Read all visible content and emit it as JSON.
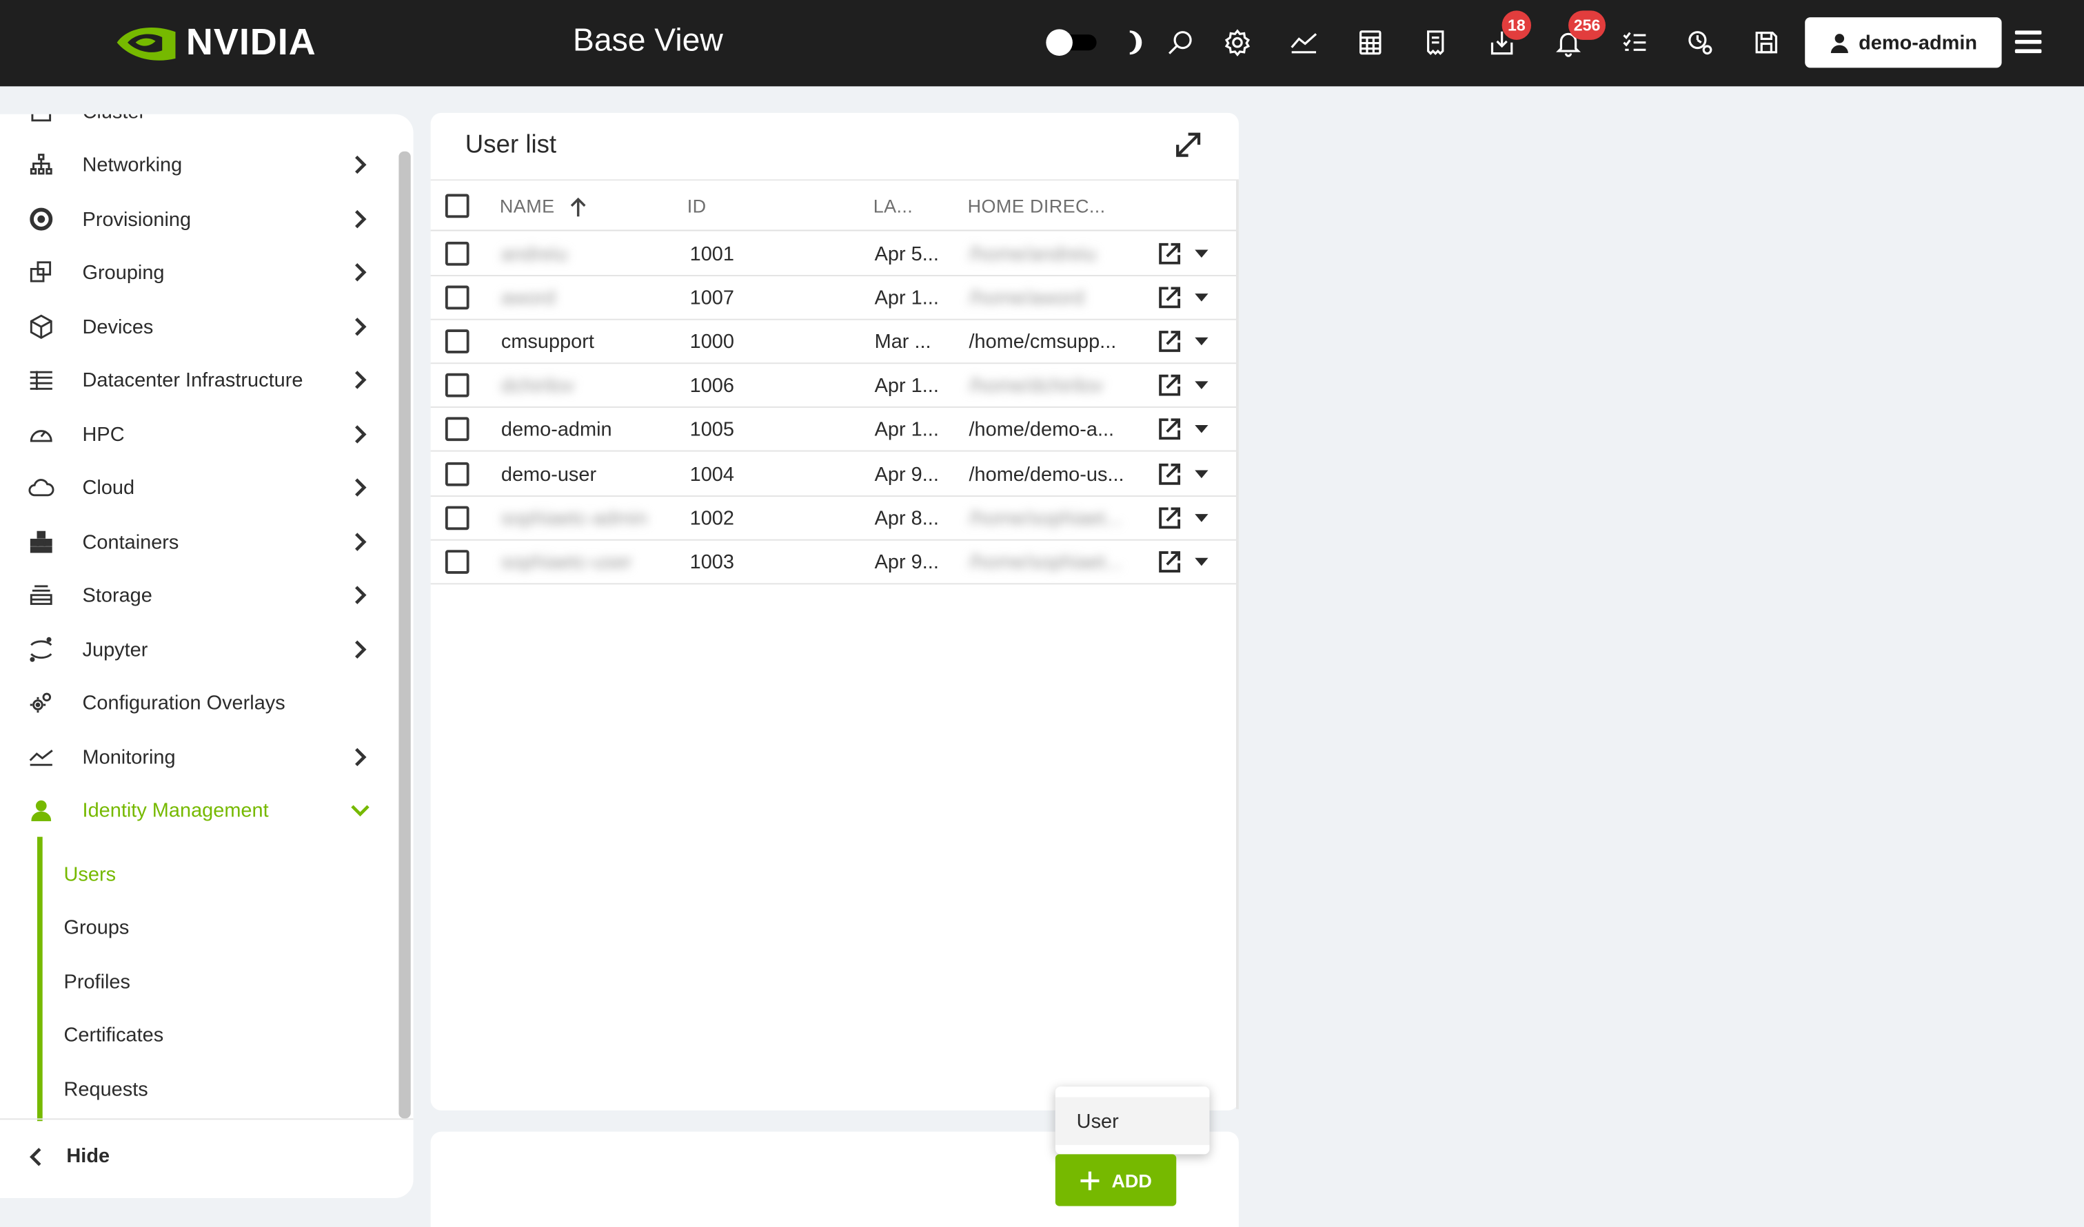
{
  "header": {
    "brand": "NVIDIA",
    "app_title": "Base View",
    "user_label": "demo-admin",
    "downloads_badge": "18",
    "notifications_badge": "256"
  },
  "sidebar": {
    "partial_top_item": "Cluster",
    "items": [
      {
        "label": "Networking",
        "icon": "network-icon"
      },
      {
        "label": "Provisioning",
        "icon": "provisioning-icon"
      },
      {
        "label": "Grouping",
        "icon": "grouping-icon"
      },
      {
        "label": "Devices",
        "icon": "cube-icon"
      },
      {
        "label": "Datacenter Infrastructure",
        "icon": "rack-icon"
      },
      {
        "label": "HPC",
        "icon": "gauge-icon"
      },
      {
        "label": "Cloud",
        "icon": "cloud-icon"
      },
      {
        "label": "Containers",
        "icon": "containers-icon"
      },
      {
        "label": "Storage",
        "icon": "storage-icon"
      },
      {
        "label": "Jupyter",
        "icon": "jupyter-icon"
      },
      {
        "label": "Configuration Overlays",
        "icon": "gears-icon"
      },
      {
        "label": "Monitoring",
        "icon": "chart-icon"
      },
      {
        "label": "Identity Management",
        "icon": "person-icon"
      }
    ],
    "sub_items": [
      "Users",
      "Groups",
      "Profiles",
      "Certificates",
      "Requests"
    ],
    "hide_label": "Hide"
  },
  "panel": {
    "title": "User list",
    "columns": [
      "NAME",
      "ID",
      "LA...",
      "HOME DIREC..."
    ],
    "rows": [
      {
        "name": "andreiu",
        "id": "1001",
        "last": "Apr 5...",
        "home": "/home/andreiu",
        "blurred": true
      },
      {
        "name": "aword",
        "id": "1007",
        "last": "Apr 1...",
        "home": "/home/aword",
        "blurred": true
      },
      {
        "name": "cmsupport",
        "id": "1000",
        "last": "Mar ...",
        "home": "/home/cmsupp...",
        "blurred": false
      },
      {
        "name": "dchirilov",
        "id": "1006",
        "last": "Apr 1...",
        "home": "/home/dchirilov",
        "blurred": true
      },
      {
        "name": "demo-admin",
        "id": "1005",
        "last": "Apr 1...",
        "home": "/home/demo-a...",
        "blurred": false
      },
      {
        "name": "demo-user",
        "id": "1004",
        "last": "Apr 9...",
        "home": "/home/demo-us...",
        "blurred": false
      },
      {
        "name": "sophiaetc-admin",
        "id": "1002",
        "last": "Apr 8...",
        "home": "/home/sophiaet...",
        "blurred": true
      },
      {
        "name": "sophiaetc-user",
        "id": "1003",
        "last": "Apr 9...",
        "home": "/home/sophiaet...",
        "blurred": true
      }
    ]
  },
  "add": {
    "button_label": "ADD",
    "menu_items": [
      "User"
    ]
  },
  "colors": {
    "accent": "#76b900",
    "topbar": "#1f1f1f",
    "badge": "#e23d3d"
  }
}
